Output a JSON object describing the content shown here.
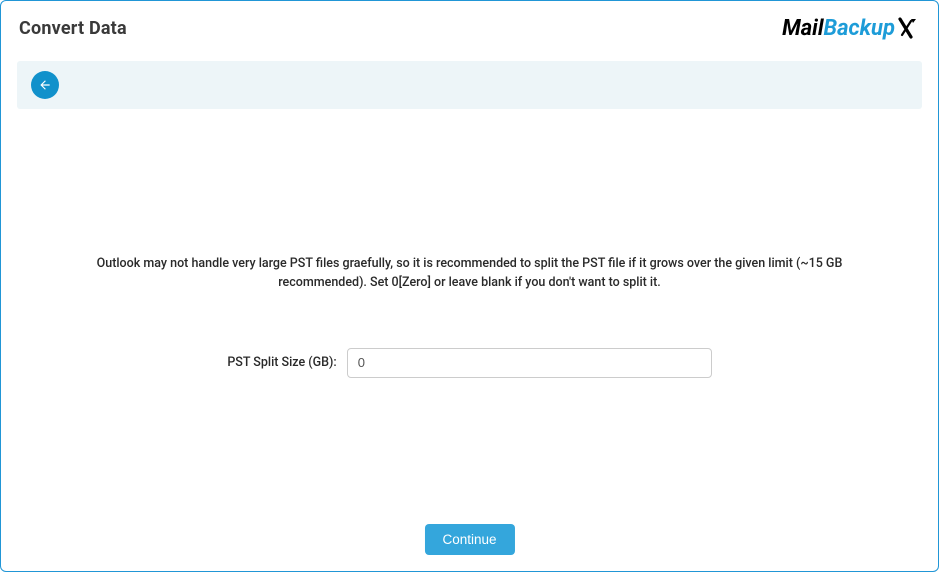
{
  "header": {
    "title": "Convert Data",
    "logo": {
      "part1": "Mail",
      "part2": "Backup"
    }
  },
  "toolbar": {
    "back_icon": "back-arrow-icon"
  },
  "main": {
    "description": "Outlook may not handle very large PST files graefully, so it is recommended to split the PST file if it grows over the given limit (~15 GB recommended). Set 0[Zero] or leave blank if you don't want to split it.",
    "form": {
      "label": "PST Split Size (GB):",
      "value": "0"
    }
  },
  "footer": {
    "continue_label": "Continue"
  }
}
